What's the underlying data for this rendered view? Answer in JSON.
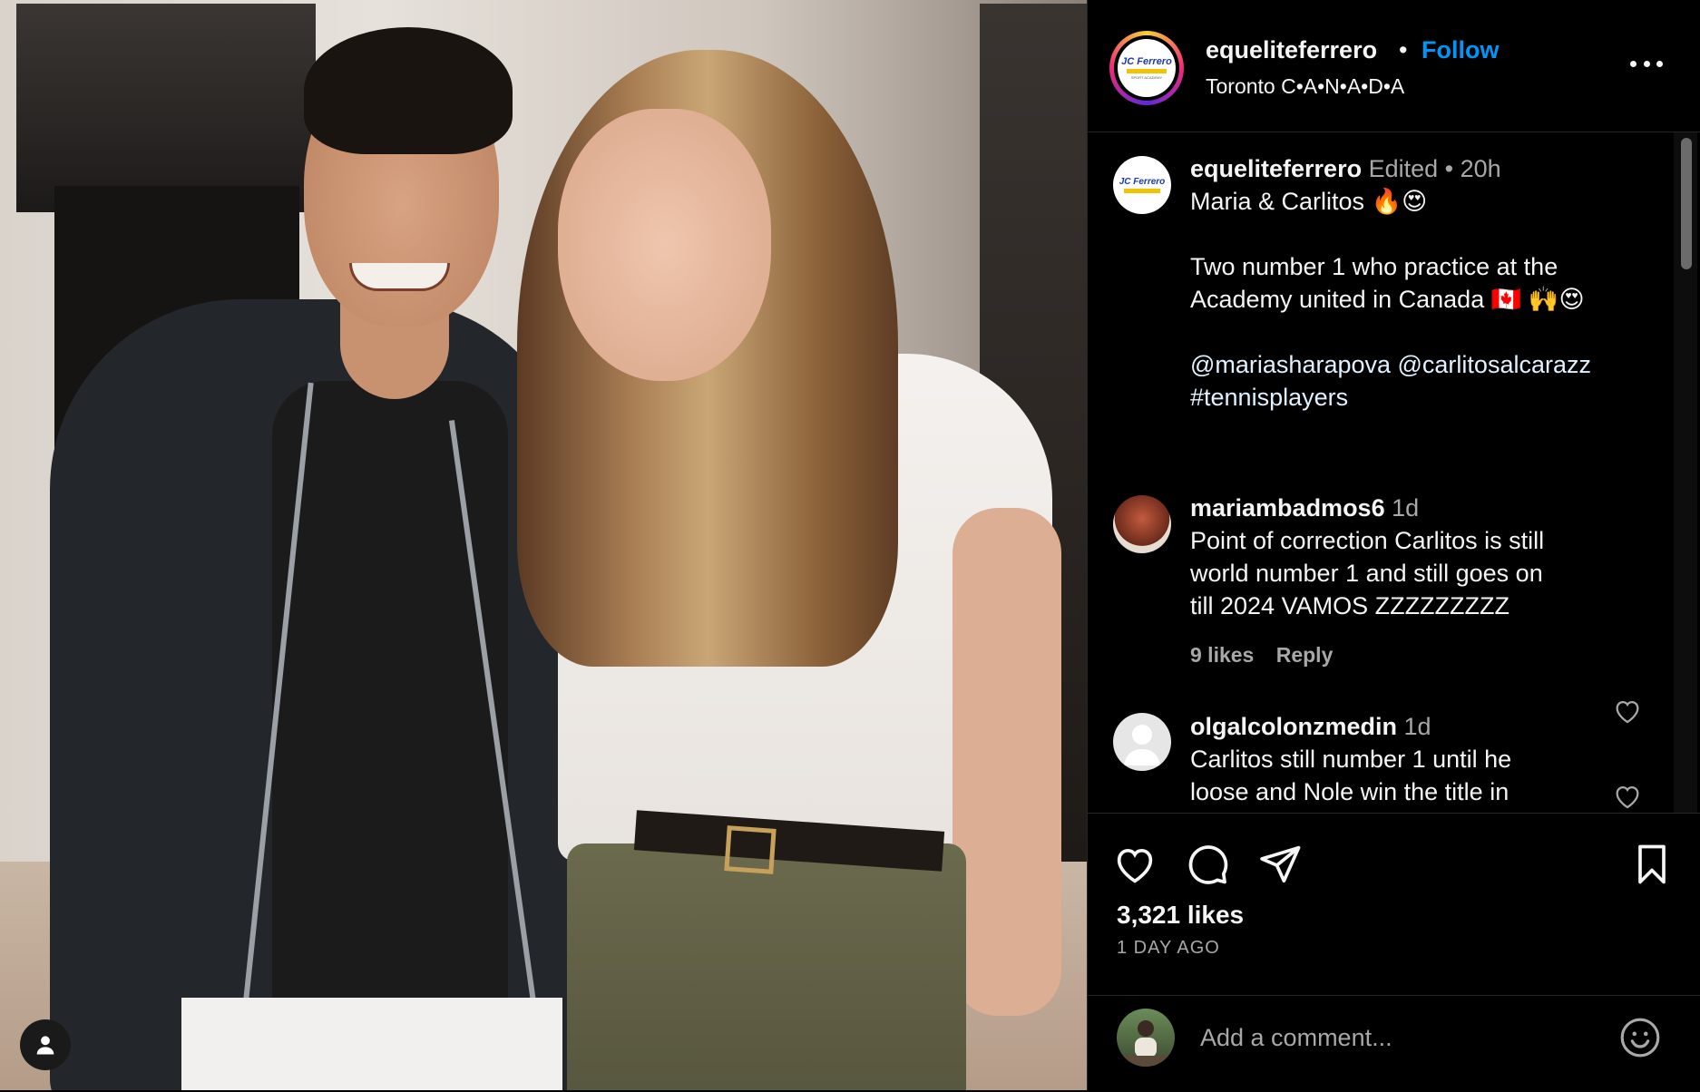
{
  "post": {
    "author": "equeliteferrero",
    "follow_label": "Follow",
    "dot": "•",
    "location": "Toronto C•A•N•A•D•A",
    "logo_text": "JC Ferrero",
    "logo_sub": "SPORT ACADEMY"
  },
  "caption": {
    "author": "equeliteferrero",
    "edited": "Edited",
    "dot": "•",
    "time": "20h",
    "line1": "Maria & Carlitos 🔥😍",
    "line2": "Two number 1 who practice at the",
    "line3": "Academy united in Canada 🇨🇦 🙌😍",
    "line4": "@mariasharapova @carlitosalcarazz",
    "line5": "#tennisplayers"
  },
  "comments": [
    {
      "user": "mariambadmos6",
      "time": "1d",
      "lines": [
        "Point of correction Carlitos is still",
        "world number 1 and still goes on",
        "till 2024 VAMOS ZZZZZZZZZ"
      ],
      "likes": "9 likes",
      "reply": "Reply"
    },
    {
      "user": "olgalcolonzmedin",
      "time": "1d",
      "lines": [
        "Carlitos still number 1 until he",
        "loose and Nole win the title in"
      ]
    }
  ],
  "footer": {
    "likes": "3,321 likes",
    "ago": "1 DAY AGO",
    "comment_placeholder": "Add a comment..."
  },
  "icons": {
    "like": "heart-icon",
    "comment": "comment-icon",
    "share": "send-icon",
    "save": "bookmark-icon",
    "emoji": "emoji-icon",
    "more": "more-icon",
    "tag": "user-tag-icon"
  },
  "colors": {
    "background": "#000000",
    "text": "#f5f5f5",
    "muted": "#a8a8a8",
    "follow": "#0095f6"
  }
}
